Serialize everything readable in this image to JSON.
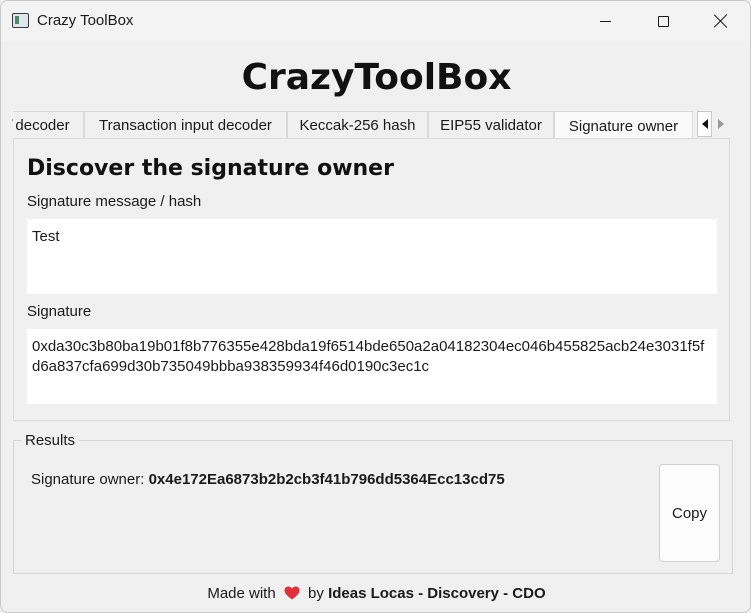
{
  "window": {
    "title": "Crazy ToolBox"
  },
  "app": {
    "title": "CrazyToolBox"
  },
  "tabs": [
    {
      "label": "decoder",
      "active": false
    },
    {
      "label": "Transaction input decoder",
      "active": false
    },
    {
      "label": "Keccak-256 hash",
      "active": false
    },
    {
      "label": "EIP55 validator",
      "active": false
    },
    {
      "label": "Signature owner",
      "active": true
    }
  ],
  "panel": {
    "heading": "Discover the signature owner",
    "message_label": "Signature message / hash",
    "message_value": "Test",
    "signature_label": "Signature",
    "signature_value": "0xda30c3b80ba19b01f8b776355e428bda19f6514bde650a2a04182304ec046b455825acb24e3031f5fd6a837cfa699d30b735049bbba938359934f46d0190c3ec1c"
  },
  "results": {
    "legend": "Results",
    "owner_label": "Signature owner: ",
    "owner_value": "0x4e172Ea6873b2b2cb3f41b796dd5364Ecc13cd75",
    "copy_label": "Copy"
  },
  "footer": {
    "prefix": "Made with",
    "middle": "by",
    "author": "Ideas Locas - Discovery - CDO"
  },
  "colors": {
    "heart": "#e0303c",
    "background": "#f0f0f0"
  },
  "icons": {
    "app": "app-window-icon",
    "heart": "heart-icon"
  }
}
